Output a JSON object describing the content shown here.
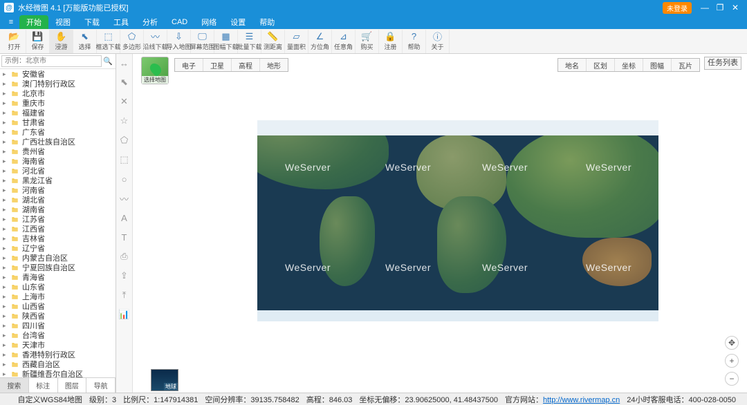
{
  "app": {
    "title": "水经微图 4.1 [万能版功能已授权]",
    "login_badge": "未登录"
  },
  "menu": {
    "items": [
      "开始",
      "视图",
      "下载",
      "工具",
      "分析",
      "CAD",
      "网络",
      "设置",
      "帮助"
    ],
    "active_index": 0
  },
  "ribbon": {
    "items": [
      {
        "label": "打开",
        "icon": "📂"
      },
      {
        "label": "保存",
        "icon": "💾"
      },
      {
        "label": "浸游",
        "icon": "✋",
        "selected": true
      },
      {
        "label": "选择",
        "icon": "⬉"
      },
      {
        "label": "框选下载",
        "icon": "⬚"
      },
      {
        "label": "多边形",
        "icon": "⬠"
      },
      {
        "label": "沿线下载",
        "icon": "〰"
      },
      {
        "label": "导入地图",
        "icon": "⇩"
      },
      {
        "label": "屏幕范围",
        "icon": "🖵"
      },
      {
        "label": "图幅下载",
        "icon": "▦"
      },
      {
        "label": "批量下载",
        "icon": "☰"
      },
      {
        "label": "测距离",
        "icon": "📏"
      },
      {
        "label": "量面积",
        "icon": "▱"
      },
      {
        "label": "方位角",
        "icon": "∠"
      },
      {
        "label": "任意角",
        "icon": "⊿"
      },
      {
        "label": "购买",
        "icon": "🛒"
      },
      {
        "label": "注册",
        "icon": "🔒"
      },
      {
        "label": "帮助",
        "icon": "?"
      },
      {
        "label": "关于",
        "icon": "ⓘ"
      }
    ]
  },
  "search": {
    "placeholder": "示例：北京市"
  },
  "tree": {
    "items": [
      "安徽省",
      "澳门特别行政区",
      "北京市",
      "重庆市",
      "福建省",
      "甘肃省",
      "广东省",
      "广西壮族自治区",
      "贵州省",
      "海南省",
      "河北省",
      "黑龙江省",
      "河南省",
      "湖北省",
      "湖南省",
      "江苏省",
      "江西省",
      "吉林省",
      "辽宁省",
      "内蒙古自治区",
      "宁夏回族自治区",
      "青海省",
      "山东省",
      "上海市",
      "山西省",
      "陕西省",
      "四川省",
      "台湾省",
      "天津市",
      "香港特别行政区",
      "西藏自治区",
      "新疆维吾尔自治区"
    ]
  },
  "left_tabs": {
    "items": [
      "搜索",
      "标注",
      "图层",
      "导航"
    ],
    "active_index": 0
  },
  "map_thumb": {
    "label": "选择地图"
  },
  "mode_tabs_left": [
    "电子",
    "卫星",
    "高程",
    "地形"
  ],
  "mode_tabs_right": [
    "地名",
    "区划",
    "坐标",
    "图幅",
    "瓦片"
  ],
  "task_button": "任务列表",
  "watermark": "WeServer",
  "bottom_thumb": {
    "label": "地球"
  },
  "zoom": {
    "pan": "✥",
    "in": "+",
    "out": "−"
  },
  "status": {
    "proj": "自定义WGS84地图",
    "level_label": "级别：",
    "level": "3",
    "scale_label": "比例尺：",
    "scale": "1:147914381",
    "res_label": "空间分辨率：",
    "res": "39135.758482",
    "elev_label": "高程：",
    "elev": "846.03",
    "coord_label": "坐标无偏移：",
    "coord": "23.90625000, 41.48437500",
    "site_label": "官方网站：",
    "site_url": "http://www.rivermap.cn",
    "hotline": "24小时客服电话：400-028-0050"
  },
  "side_tools": [
    "↔",
    "⬉",
    "✕",
    "☆",
    "⬠",
    "⬚",
    "○",
    "〰",
    "A",
    "T",
    "⎙",
    "⇪",
    "⤒",
    "📊"
  ]
}
